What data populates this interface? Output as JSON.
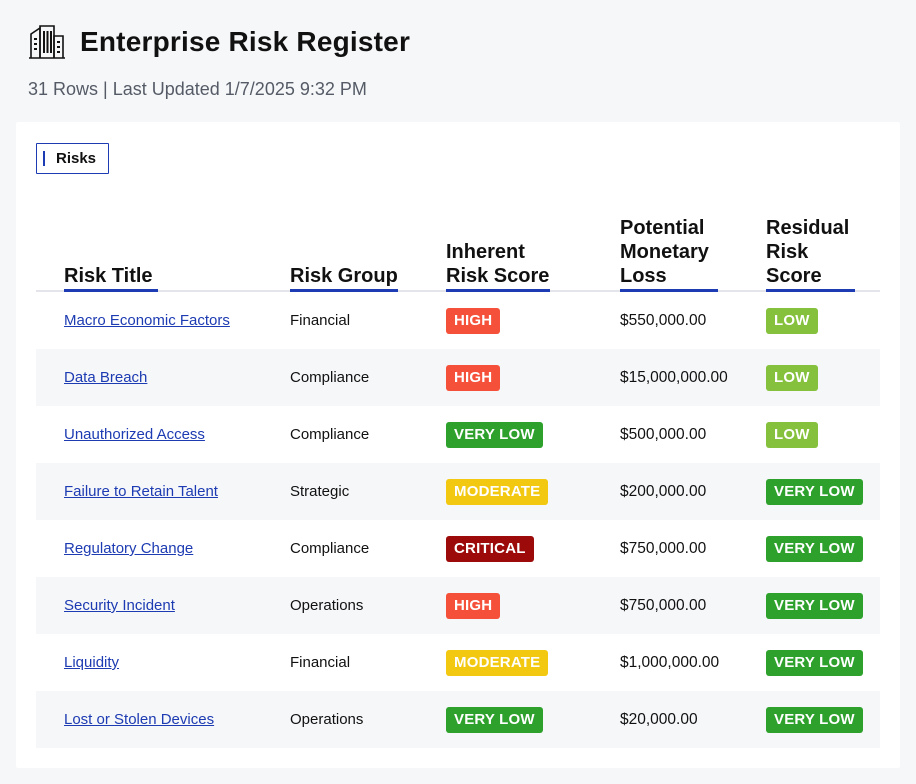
{
  "app": {
    "title": "Enterprise Risk Register",
    "subtitle": "31 Rows | Last Updated 1/7/2025 9:32 PM",
    "icon": "building-icon"
  },
  "tabs": [
    {
      "label": "Risks",
      "active": true
    }
  ],
  "table": {
    "headers": {
      "title": "Risk Title",
      "group": "Risk Group",
      "inherent": "Inherent Risk Score",
      "loss": "Potential Monetary Loss",
      "residual": "Residual Risk Score"
    },
    "rows": [
      {
        "title": "Macro Economic Factors",
        "group": "Financial",
        "inherent": "HIGH",
        "loss": "$550,000.00",
        "residual": "LOW"
      },
      {
        "title": "Data Breach",
        "group": "Compliance",
        "inherent": "HIGH",
        "loss": "$15,000,000.00",
        "residual": "LOW"
      },
      {
        "title": "Unauthorized Access",
        "group": "Compliance",
        "inherent": "VERY LOW",
        "loss": "$500,000.00",
        "residual": "LOW"
      },
      {
        "title": "Failure to Retain Talent",
        "group": "Strategic",
        "inherent": "MODERATE",
        "loss": "$200,000.00",
        "residual": "VERY LOW"
      },
      {
        "title": "Regulatory Change",
        "group": "Compliance",
        "inherent": "CRITICAL",
        "loss": "$750,000.00",
        "residual": "VERY LOW"
      },
      {
        "title": "Security Incident",
        "group": "Operations",
        "inherent": "HIGH",
        "loss": "$750,000.00",
        "residual": "VERY LOW"
      },
      {
        "title": "Liquidity",
        "group": "Financial",
        "inherent": "MODERATE",
        "loss": "$1,000,000.00",
        "residual": "VERY LOW"
      },
      {
        "title": "Lost or Stolen Devices",
        "group": "Operations",
        "inherent": "VERY LOW",
        "loss": "$20,000.00",
        "residual": "VERY LOW"
      }
    ]
  },
  "colors": {
    "accent": "#1d3bb2",
    "link": "#1d3bb2",
    "badges": {
      "CRITICAL": "#9c0a0a",
      "HIGH": "#f5503a",
      "MODERATE": "#f2c811",
      "LOW": "#85c13c",
      "VERY LOW": "#2ea12d"
    }
  }
}
